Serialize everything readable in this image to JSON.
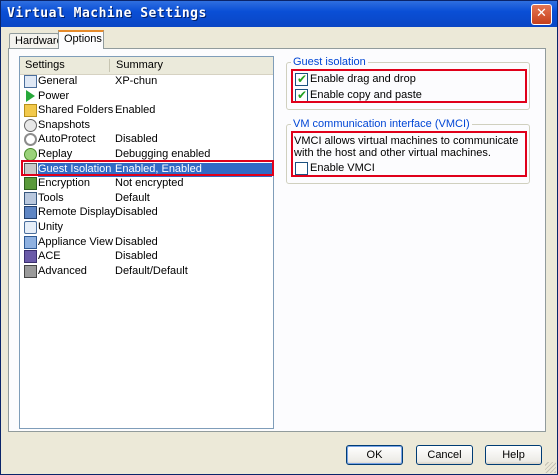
{
  "window": {
    "title": "Virtual Machine Settings",
    "close_glyph": "✕"
  },
  "tabs": [
    {
      "label": "Hardware",
      "active": false
    },
    {
      "label": "Options",
      "active": true
    }
  ],
  "list": {
    "columns": [
      "Settings",
      "Summary"
    ],
    "rows": [
      {
        "label": "General",
        "summary": "XP-chun",
        "icon": "general-icon"
      },
      {
        "label": "Power",
        "summary": "",
        "icon": "power-icon"
      },
      {
        "label": "Shared Folders",
        "summary": "Enabled",
        "icon": "folder-icon"
      },
      {
        "label": "Snapshots",
        "summary": "",
        "icon": "snapshot-icon"
      },
      {
        "label": "AutoProtect",
        "summary": "Disabled",
        "icon": "autoprotect-icon"
      },
      {
        "label": "Replay",
        "summary": "Debugging enabled",
        "icon": "replay-icon"
      },
      {
        "label": "Guest Isolation",
        "summary": "Enabled, Enabled",
        "icon": "guest-isolation-icon",
        "selected": true
      },
      {
        "label": "Encryption",
        "summary": "Not encrypted",
        "icon": "encryption-icon"
      },
      {
        "label": "Tools",
        "summary": "Default",
        "icon": "tools-icon"
      },
      {
        "label": "Remote Display",
        "summary": "Disabled",
        "icon": "remote-display-icon"
      },
      {
        "label": "Unity",
        "summary": "",
        "icon": "unity-icon"
      },
      {
        "label": "Appliance View",
        "summary": "Disabled",
        "icon": "appliance-view-icon"
      },
      {
        "label": "ACE",
        "summary": "Disabled",
        "icon": "ace-icon"
      },
      {
        "label": "Advanced",
        "summary": "Default/Default",
        "icon": "advanced-icon"
      }
    ]
  },
  "guest_isolation": {
    "legend": "Guest isolation",
    "drag_drop": {
      "label": "Enable drag and drop",
      "checked": true
    },
    "copy_paste": {
      "label": "Enable copy and paste",
      "checked": true
    }
  },
  "vmci": {
    "legend": "VM communication interface (VMCI)",
    "description": "VMCI allows virtual machines to communicate with the host and other virtual machines.",
    "enable": {
      "label": "Enable VMCI",
      "checked": false
    }
  },
  "buttons": {
    "ok": "OK",
    "cancel": "Cancel",
    "help": "Help"
  },
  "colors": {
    "selection": "#316ac5",
    "highlight_box": "#e0001a",
    "legend": "#0046d5"
  }
}
